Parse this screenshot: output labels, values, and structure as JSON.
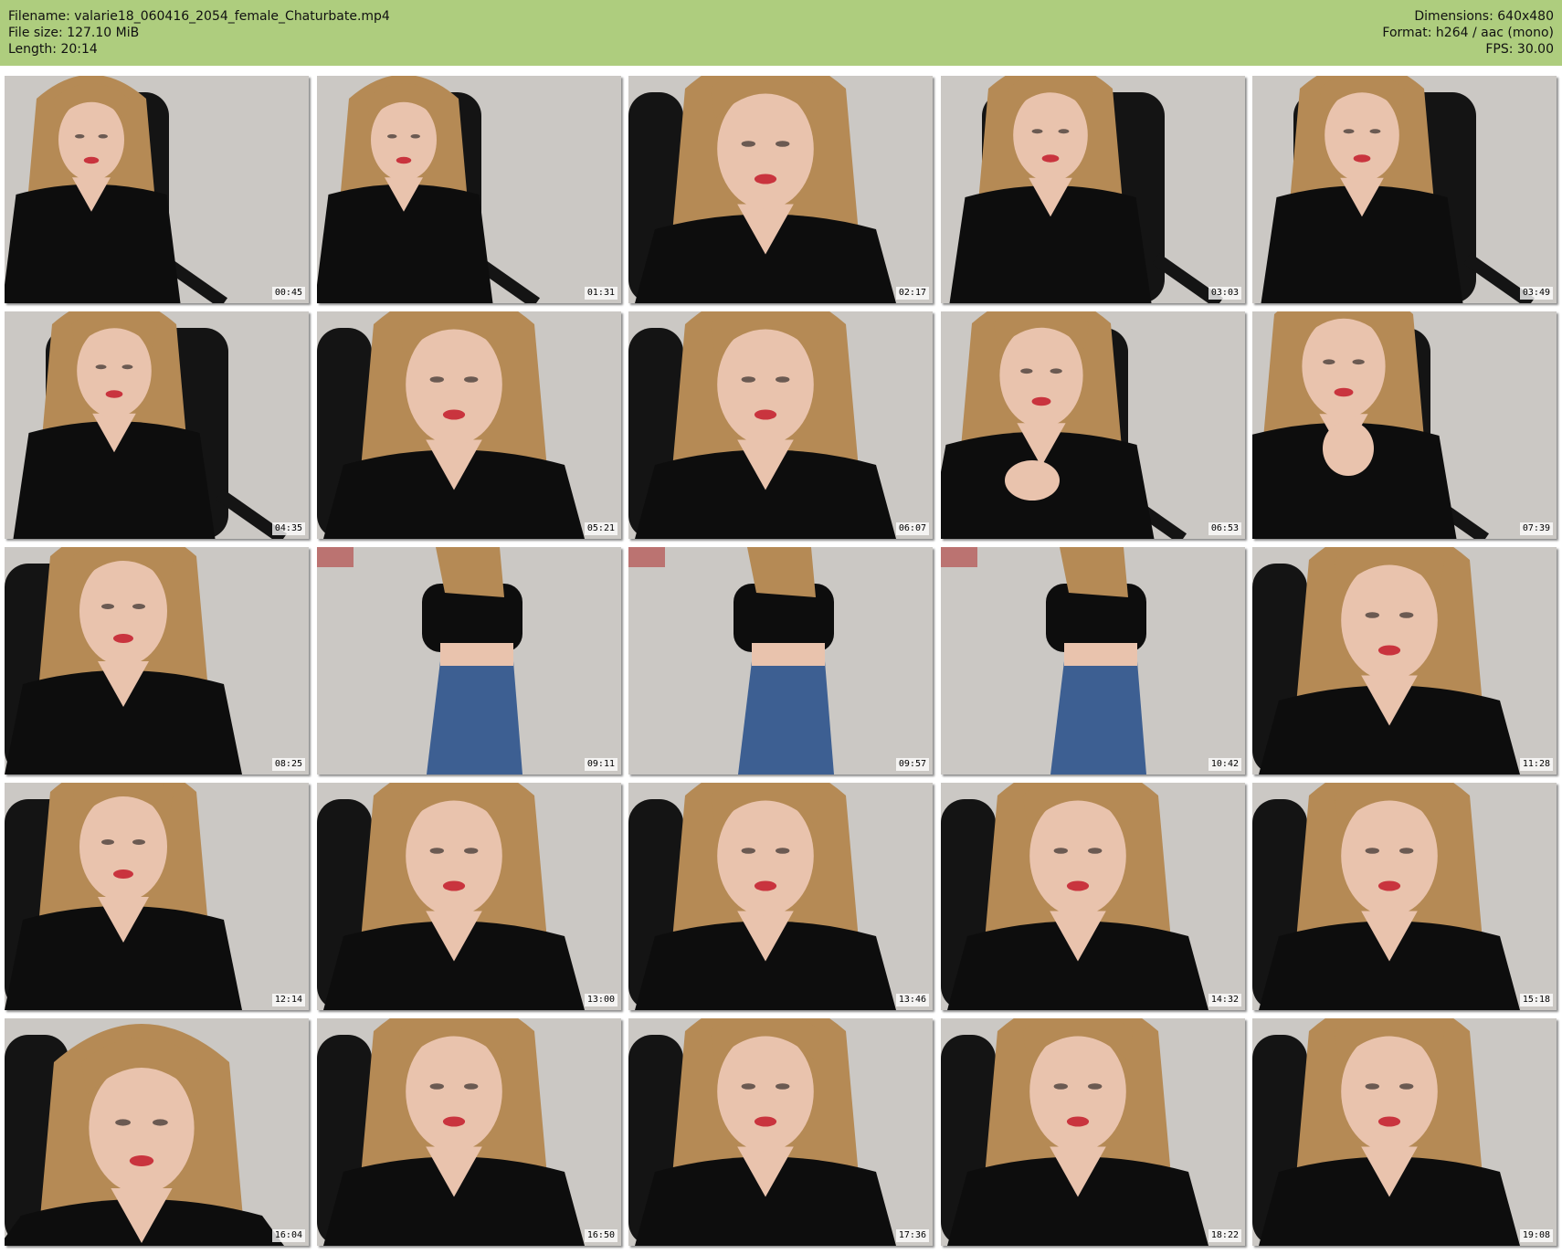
{
  "header": {
    "filename_label": "Filename: valarie18_060416_2054_female_Chaturbate.mp4",
    "filesize_label": "File size: 127.10 MiB",
    "length_label": "Length: 20:14",
    "dimensions_label": "Dimensions: 640x480",
    "format_label": "Format: h264 / aac (mono)",
    "fps_label": "FPS: 30.00"
  },
  "colors": {
    "header_bg": "#aecd7e",
    "wall": "#cbc8c4",
    "chair": "#141414",
    "hair": "#b58a55",
    "skin": "#e9c3ad",
    "top": "#0d0d0d",
    "jeans": "#3d5f92",
    "lips": "#c9343e"
  },
  "thumbnails": [
    {
      "time": "00:45",
      "scene": "sitting-leaning"
    },
    {
      "time": "01:31",
      "scene": "sitting-leaning"
    },
    {
      "time": "02:17",
      "scene": "close"
    },
    {
      "time": "03:03",
      "scene": "sitting"
    },
    {
      "time": "03:49",
      "scene": "sitting"
    },
    {
      "time": "04:35",
      "scene": "sitting"
    },
    {
      "time": "05:21",
      "scene": "close"
    },
    {
      "time": "06:07",
      "scene": "close"
    },
    {
      "time": "06:53",
      "scene": "hands"
    },
    {
      "time": "07:39",
      "scene": "hand-face"
    },
    {
      "time": "08:25",
      "scene": "close-side"
    },
    {
      "time": "09:11",
      "scene": "standing-back"
    },
    {
      "time": "09:57",
      "scene": "standing-front"
    },
    {
      "time": "10:42",
      "scene": "standing-back"
    },
    {
      "time": "11:28",
      "scene": "close"
    },
    {
      "time": "12:14",
      "scene": "close-side"
    },
    {
      "time": "13:00",
      "scene": "close"
    },
    {
      "time": "13:46",
      "scene": "close"
    },
    {
      "time": "14:32",
      "scene": "close"
    },
    {
      "time": "15:18",
      "scene": "close"
    },
    {
      "time": "16:04",
      "scene": "smile-tilt"
    },
    {
      "time": "16:50",
      "scene": "close"
    },
    {
      "time": "17:36",
      "scene": "close"
    },
    {
      "time": "18:22",
      "scene": "close"
    },
    {
      "time": "19:08",
      "scene": "close"
    }
  ]
}
